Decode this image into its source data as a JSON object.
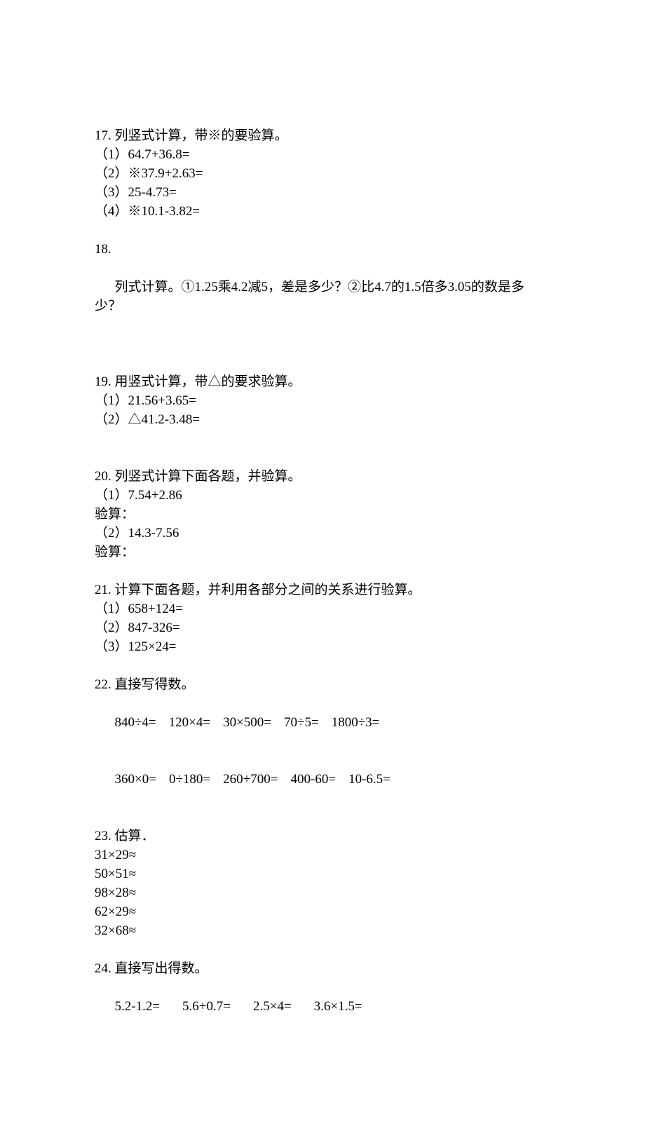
{
  "q17": {
    "title": "17. 列竖式计算，带※的要验算。",
    "items": [
      "（1）64.7+36.8=",
      "（2）※37.9+2.63=",
      "（3）25-4.73=",
      "（4）※10.1-3.82="
    ]
  },
  "q18": {
    "num": "18.",
    "prefix": "列式计算。",
    "c1": "①",
    "p1": "1.25乘4.2减5，差是多少？",
    "c2": "②",
    "p2": "比4.7的1.5倍多3.05的数是多少？"
  },
  "q19": {
    "title": "19. 用竖式计算，带△的要求验算。",
    "items": [
      "（1）21.56+3.65=",
      "（2）△41.2-3.48="
    ]
  },
  "q20": {
    "title": "20. 列竖式计算下面各题，并验算。",
    "lines": [
      "（1）7.54+2.86",
      "验算：",
      "（2）14.3-7.56",
      "验算："
    ]
  },
  "q21": {
    "title": "21. 计算下面各题，并利用各部分之间的关系进行验算。",
    "items": [
      "（1）658+124=",
      "（2）847-326=",
      "（3）125×24="
    ]
  },
  "q22": {
    "title": "22. 直接写得数。",
    "row1": {
      "a": "840÷4=",
      "b": "120×4=",
      "c": "30×500=",
      "d": "70÷5=",
      "e": "1800÷3="
    },
    "row2": {
      "a": "360×0=",
      "b": "0÷180=",
      "c": "260+700=",
      "d": "400-60=",
      "e": "10-6.5="
    }
  },
  "q23": {
    "title": "23. 估算．",
    "items": [
      "31×29≈",
      "50×51≈",
      "98×28≈",
      "62×29≈",
      "32×68≈"
    ]
  },
  "q24": {
    "title": "24. 直接写出得数。",
    "row": {
      "a": "5.2-1.2=",
      "b": "5.6+0.7=",
      "c": "2.5×4=",
      "d": "3.6×1.5="
    }
  }
}
